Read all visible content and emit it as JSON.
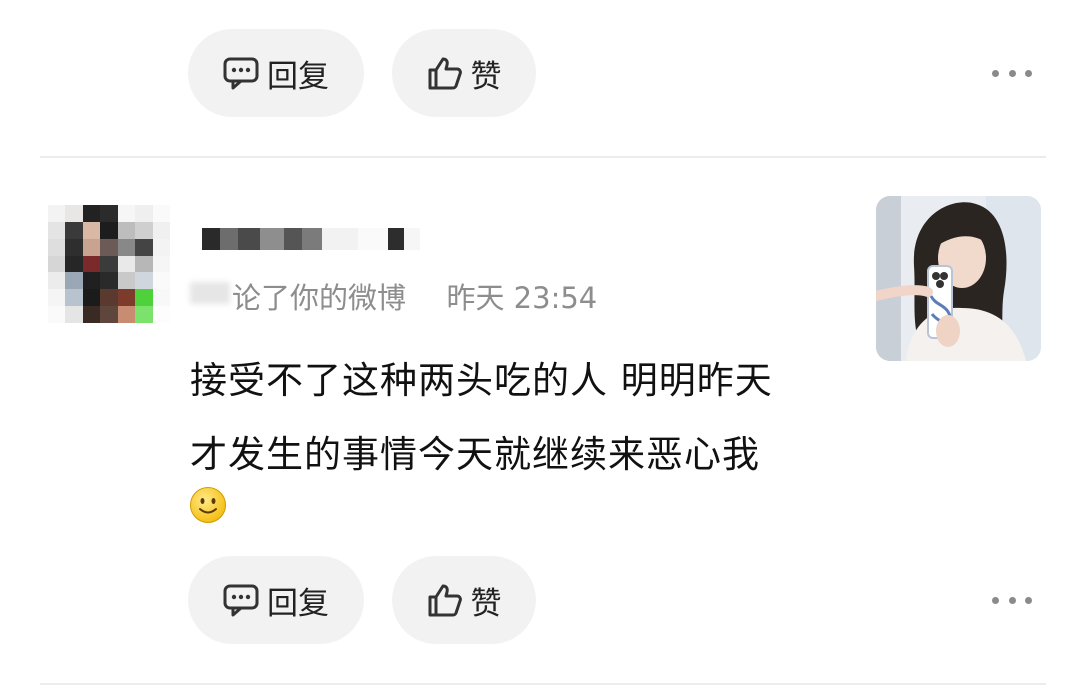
{
  "actions": {
    "reply_label": "回复",
    "like_label": "赞"
  },
  "comment": {
    "meta_action": "论了你的微博",
    "timestamp": "昨天 23:54",
    "text_line1": "接受不了这种两头吃的人 明明昨天",
    "text_line2": "才发生的事情今天就继续来恶心我",
    "emoji": "smile-emoji"
  },
  "icons": {
    "reply": "comment-bubble-icon",
    "like": "thumbs-up-icon",
    "more": "more-dots-icon"
  },
  "colors": {
    "pill_bg": "#f2f2f2",
    "meta_text": "#8d8d8d",
    "divider": "#ececec"
  }
}
